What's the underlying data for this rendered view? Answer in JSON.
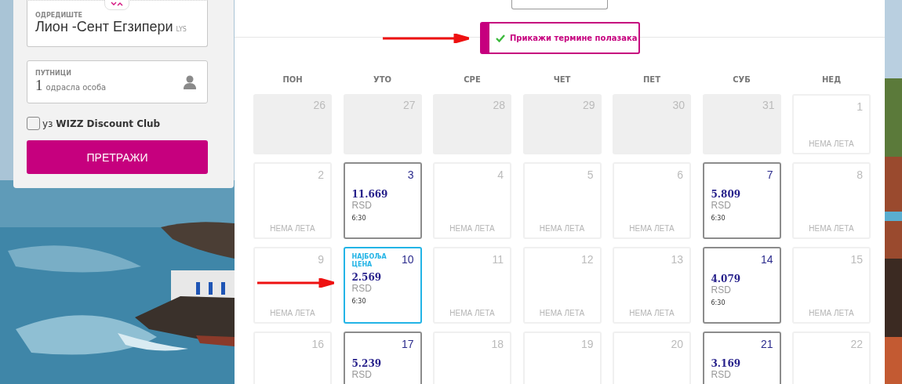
{
  "search_panel": {
    "destination": {
      "label": "ОДРЕДИШТЕ",
      "value": "Лион -Сент Егзипери",
      "code": "LYS"
    },
    "passengers": {
      "label": "ПУТНИЦИ",
      "count": "1",
      "unit": "одрасла особа"
    },
    "discount_club": {
      "label": "уз **WIZZ Discount Club**",
      "checked": false
    },
    "search_button": "ПРЕТРАЖИ"
  },
  "departure_toggle": {
    "label": "Прикажи термине полазака",
    "checked": true
  },
  "weekdays": [
    "ПОН",
    "УТО",
    "СРЕ",
    "ЧЕТ",
    "ПЕТ",
    "СУБ",
    "НЕД"
  ],
  "weeks": [
    [
      {
        "kind": "past",
        "day": "26"
      },
      {
        "kind": "past",
        "day": "27"
      },
      {
        "kind": "past",
        "day": "28"
      },
      {
        "kind": "past",
        "day": "29"
      },
      {
        "kind": "past",
        "day": "30"
      },
      {
        "kind": "past",
        "day": "31"
      },
      {
        "kind": "none",
        "day": "1",
        "label": "НЕМА ЛЕТА"
      }
    ],
    [
      {
        "kind": "none",
        "day": "2",
        "label": "НЕМА ЛЕТА"
      },
      {
        "kind": "flight",
        "day": "3",
        "price": "11.669",
        "currency": "RSD",
        "time": "6:30"
      },
      {
        "kind": "none",
        "day": "4",
        "label": "НЕМА ЛЕТА"
      },
      {
        "kind": "none",
        "day": "5",
        "label": "НЕМА ЛЕТА"
      },
      {
        "kind": "none",
        "day": "6",
        "label": "НЕМА ЛЕТА"
      },
      {
        "kind": "flight",
        "day": "7",
        "price": "5.809",
        "currency": "RSD",
        "time": "6:30"
      },
      {
        "kind": "none",
        "day": "8",
        "label": "НЕМА ЛЕТА"
      }
    ],
    [
      {
        "kind": "none",
        "day": "9",
        "label": "НЕМА ЛЕТА"
      },
      {
        "kind": "best",
        "day": "10",
        "badge": "НАЈБОЉА ЦЕНА",
        "price": "2.569",
        "currency": "RSD",
        "time": "6:30"
      },
      {
        "kind": "none",
        "day": "11",
        "label": "НЕМА ЛЕТА"
      },
      {
        "kind": "none",
        "day": "12",
        "label": "НЕМА ЛЕТА"
      },
      {
        "kind": "none",
        "day": "13",
        "label": "НЕМА ЛЕТА"
      },
      {
        "kind": "flight",
        "day": "14",
        "price": "4.079",
        "currency": "RSD",
        "time": "6:30"
      },
      {
        "kind": "none",
        "day": "15",
        "label": "НЕМА ЛЕТА"
      }
    ],
    [
      {
        "kind": "none",
        "day": "16"
      },
      {
        "kind": "flight",
        "day": "17",
        "price": "5.239",
        "currency": "RSD"
      },
      {
        "kind": "none",
        "day": "18"
      },
      {
        "kind": "none",
        "day": "19"
      },
      {
        "kind": "none",
        "day": "20"
      },
      {
        "kind": "flight",
        "day": "21",
        "price": "3.169",
        "currency": "RSD"
      },
      {
        "kind": "none",
        "day": "22"
      }
    ]
  ]
}
